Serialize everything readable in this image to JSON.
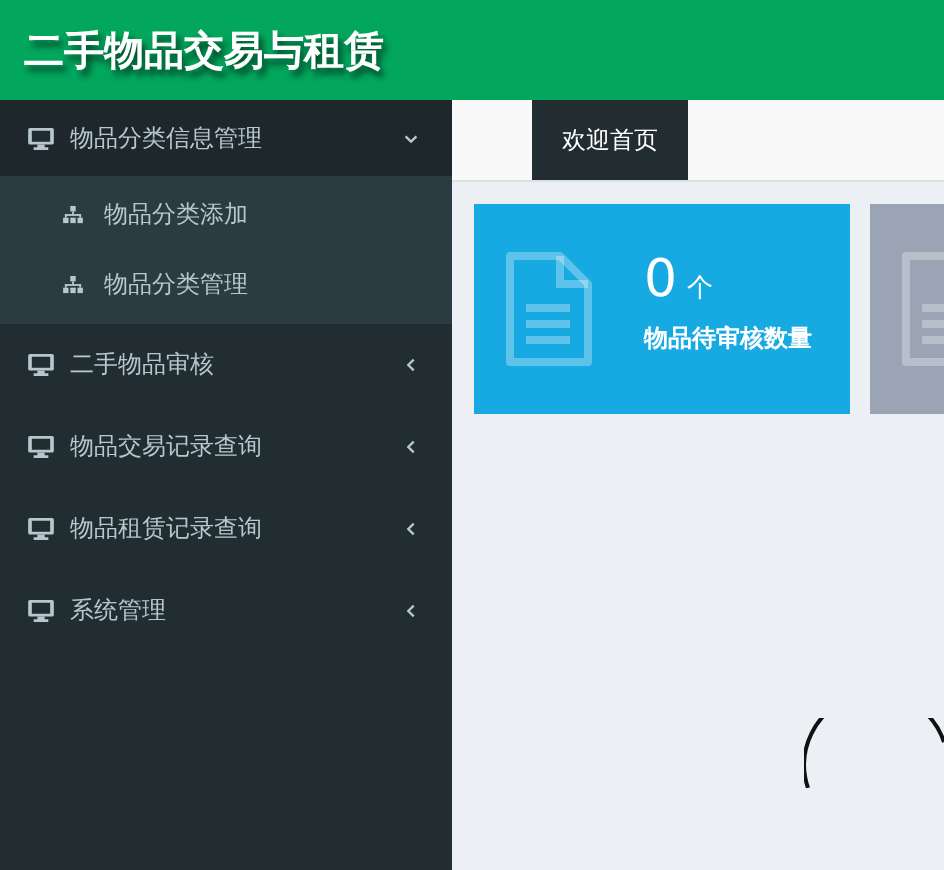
{
  "header": {
    "title": "二手物品交易与租赁"
  },
  "sidebar": {
    "items": [
      {
        "label": "物品分类信息管理",
        "expanded": true,
        "children": [
          {
            "label": "物品分类添加"
          },
          {
            "label": "物品分类管理"
          }
        ]
      },
      {
        "label": "二手物品审核",
        "expanded": false
      },
      {
        "label": "物品交易记录查询",
        "expanded": false
      },
      {
        "label": "物品租赁记录查询",
        "expanded": false
      },
      {
        "label": "系统管理",
        "expanded": false
      }
    ]
  },
  "tabs": [
    {
      "label": "欢迎首页",
      "selected": true
    }
  ],
  "cards": [
    {
      "color": "#17a9e1",
      "value": "0",
      "unit": "个",
      "label": "物品待审核数量"
    },
    {
      "color": "#9aa4b4"
    }
  ]
}
